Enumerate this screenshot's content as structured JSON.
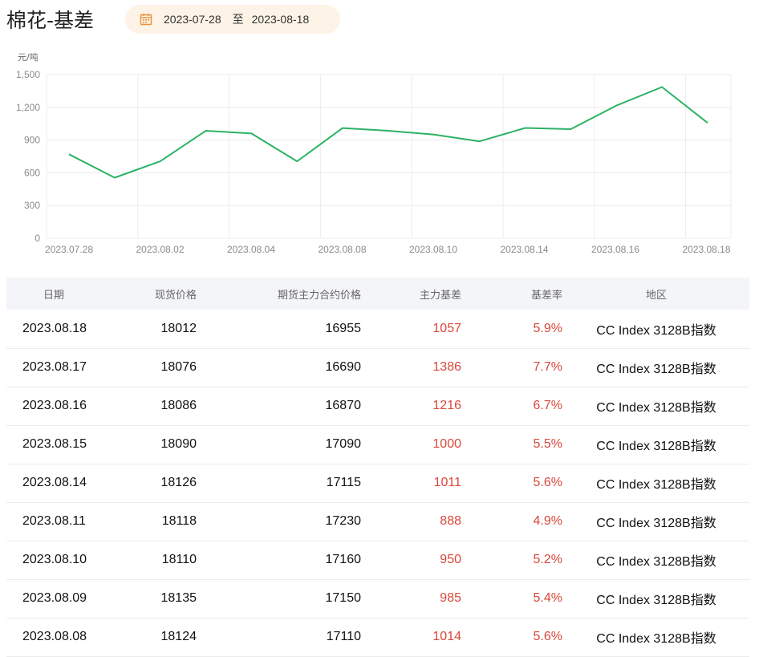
{
  "page": {
    "title": "棉花-基差",
    "date_start": "2023-07-28",
    "date_sep": "至",
    "date_end": "2023-08-18"
  },
  "colors": {
    "line": "#2db266",
    "positive": "#d9473a",
    "date_bg": "#fdf3e6",
    "header_bg": "#f4f5f8"
  },
  "chart_data": {
    "type": "line",
    "ylabel": "元/吨",
    "ylim": [
      0,
      1500
    ],
    "yticks": [
      "0",
      "300",
      "600",
      "900",
      "1,200",
      "1,500"
    ],
    "ytick_values": [
      0,
      300,
      600,
      900,
      1200,
      1500
    ],
    "xtick_labels": [
      "2023.07.28",
      "2023.08.02",
      "2023.08.04",
      "2023.08.08",
      "2023.08.10",
      "2023.08.14",
      "2023.08.16",
      "2023.08.18"
    ],
    "grid": true,
    "series": [
      {
        "x": [
          "2023.07.28",
          "2023.07.31",
          "2023.08.01",
          "2023.08.02",
          "2023.08.03",
          "2023.08.04",
          "2023.08.07",
          "2023.08.08",
          "2023.08.09",
          "2023.08.10",
          "2023.08.11",
          "2023.08.14",
          "2023.08.15",
          "2023.08.16",
          "2023.08.17",
          "2023.08.18"
        ],
        "values": [
          770,
          555,
          705,
          985,
          960,
          705,
          1010,
          985,
          950,
          888,
          1011,
          1000,
          1216,
          1386,
          1057,
          1057
        ]
      }
    ]
  },
  "table": {
    "headers": [
      "日期",
      "现货价格",
      "期货主力合约价格",
      "主力基差",
      "基差率",
      "地区"
    ],
    "rows": [
      [
        "2023.08.18",
        "18012",
        "16955",
        "1057",
        "5.9%",
        "CC Index 3128B指数"
      ],
      [
        "2023.08.17",
        "18076",
        "16690",
        "1386",
        "7.7%",
        "CC Index 3128B指数"
      ],
      [
        "2023.08.16",
        "18086",
        "16870",
        "1216",
        "6.7%",
        "CC Index 3128B指数"
      ],
      [
        "2023.08.15",
        "18090",
        "17090",
        "1000",
        "5.5%",
        "CC Index 3128B指数"
      ],
      [
        "2023.08.14",
        "18126",
        "17115",
        "1011",
        "5.6%",
        "CC Index 3128B指数"
      ],
      [
        "2023.08.11",
        "18118",
        "17230",
        "888",
        "4.9%",
        "CC Index 3128B指数"
      ],
      [
        "2023.08.10",
        "18110",
        "17160",
        "950",
        "5.2%",
        "CC Index 3128B指数"
      ],
      [
        "2023.08.09",
        "18135",
        "17150",
        "985",
        "5.4%",
        "CC Index 3128B指数"
      ],
      [
        "2023.08.08",
        "18124",
        "17110",
        "1014",
        "5.6%",
        "CC Index 3128B指数"
      ]
    ]
  }
}
